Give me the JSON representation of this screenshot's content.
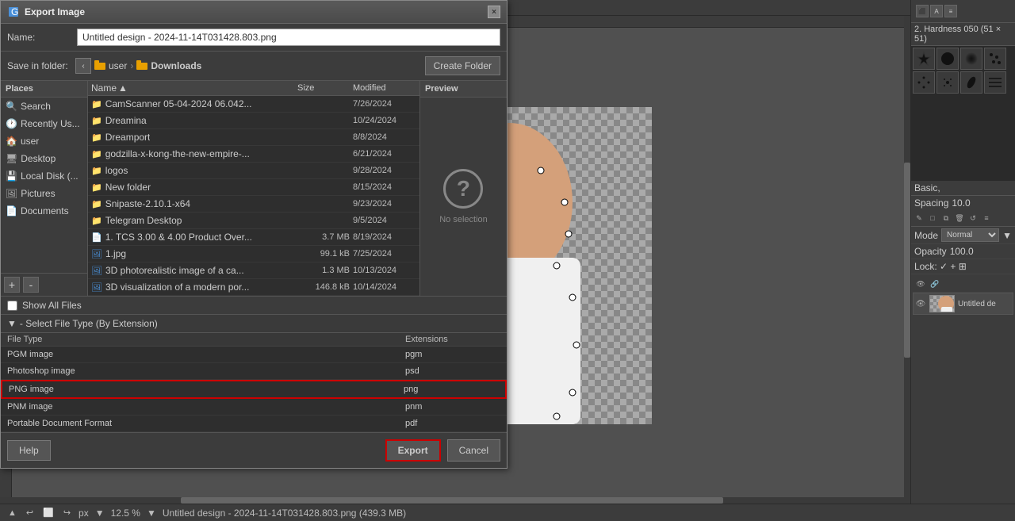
{
  "dialog": {
    "title": "Export Image",
    "close_label": "×",
    "name_label": "Name:",
    "name_value": "Untitled design - 2024-11-14T031428.803.png",
    "save_in_label": "Save in folder:",
    "nav_back": "‹",
    "breadcrumb": [
      "user",
      "Downloads"
    ],
    "create_folder_label": "Create Folder",
    "preview_label": "Preview",
    "no_selection": "No selection",
    "show_all_label": "Show All Files",
    "file_type_section_label": "- Select File Type (By Extension)",
    "file_type_col_name": "File Type",
    "file_type_col_ext": "Extensions",
    "help_label": "Help",
    "export_label": "Export",
    "cancel_label": "Cancel"
  },
  "places": {
    "header": "Places",
    "items": [
      {
        "label": "Search",
        "icon": "🔍"
      },
      {
        "label": "Recently Us...",
        "icon": "🕐"
      },
      {
        "label": "user",
        "icon": "🏠"
      },
      {
        "label": "Desktop",
        "icon": "🖥"
      },
      {
        "label": "Local Disk (...",
        "icon": "💾"
      },
      {
        "label": "Pictures",
        "icon": "🖼"
      },
      {
        "label": "Documents",
        "icon": "📄"
      }
    ],
    "add_label": "+",
    "remove_label": "-"
  },
  "files": {
    "col_name": "Name",
    "col_size": "Size",
    "col_modified": "Modified",
    "items": [
      {
        "name": "CamScanner 05-04-2024 06.042...",
        "size": "",
        "date": "7/26/2024",
        "icon": "📁"
      },
      {
        "name": "Dreamina",
        "size": "",
        "date": "10/24/2024",
        "icon": "📁"
      },
      {
        "name": "Dreamport",
        "size": "",
        "date": "8/8/2024",
        "icon": "📁"
      },
      {
        "name": "godzilla-x-kong-the-new-empire-...",
        "size": "",
        "date": "6/21/2024",
        "icon": "📁"
      },
      {
        "name": "logos",
        "size": "",
        "date": "9/28/2024",
        "icon": "📁"
      },
      {
        "name": "New folder",
        "size": "",
        "date": "8/15/2024",
        "icon": "📁"
      },
      {
        "name": "Snipaste-2.10.1-x64",
        "size": "",
        "date": "9/23/2024",
        "icon": "📁"
      },
      {
        "name": "Telegram Desktop",
        "size": "",
        "date": "9/5/2024",
        "icon": "📁"
      },
      {
        "name": "1. TCS 3.00 & 4.00 Product Over...",
        "size": "3.7 MB",
        "date": "8/19/2024",
        "icon": "📄"
      },
      {
        "name": "1.jpg",
        "size": "99.1 kB",
        "date": "7/25/2024",
        "icon": "🖼"
      },
      {
        "name": "3D photorealistic image of a ca...",
        "size": "1.3 MB",
        "date": "10/13/2024",
        "icon": "🖼"
      },
      {
        "name": "3D visualization of a modern por...",
        "size": "146.8 kB",
        "date": "10/14/2024",
        "icon": "🖼"
      }
    ]
  },
  "file_types": [
    {
      "name": "PGM image",
      "ext": "pgm"
    },
    {
      "name": "Photoshop image",
      "ext": "psd"
    },
    {
      "name": "PNG image",
      "ext": "png",
      "selected": true
    },
    {
      "name": "PNM image",
      "ext": "pnm"
    },
    {
      "name": "Portable Document Format",
      "ext": "pdf"
    }
  ],
  "right_panel": {
    "brush_label": "2. Hardness 050 (51 × 51)",
    "preset_label": "Basic,",
    "spacing_label": "Spacing",
    "spacing_value": "10.0",
    "mode_label": "Mode",
    "mode_value": "Normal",
    "opacity_label": "Opacity",
    "opacity_value": "100.0",
    "lock_label": "Lock: ✓ + ⊞",
    "layer_name": "Untitled de"
  },
  "status_bar": {
    "zoom_unit": "px",
    "zoom_level": "12.5 %",
    "filename": "Untitled design - 2024-11-14T031428.803.png (439.3 MB)"
  }
}
